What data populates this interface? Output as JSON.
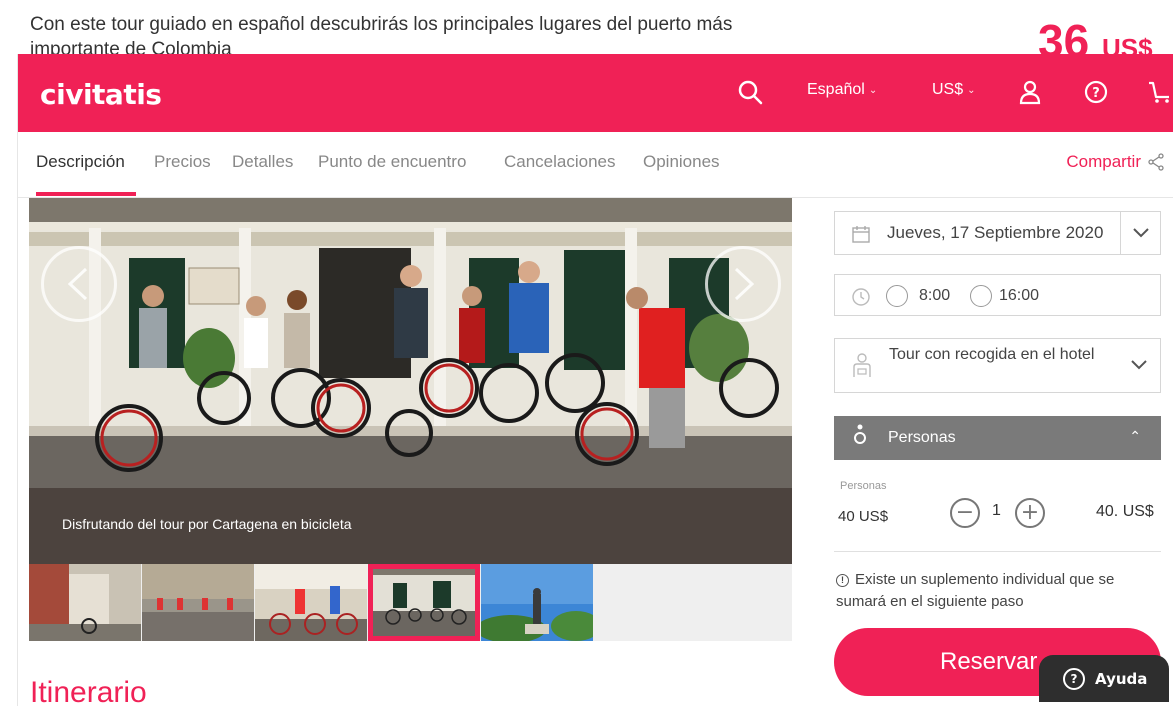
{
  "intro": {
    "text": "Con este tour guiado en español descubrirás los principales lugares del puerto más importante de Colombia",
    "price": "36",
    "currency": "US$"
  },
  "header": {
    "logo": "civitatis",
    "language": "Español",
    "currency": "US$",
    "icons": [
      "search-icon",
      "user-icon",
      "help-icon",
      "cart-icon"
    ],
    "brand_color": "#f02156"
  },
  "tabs": {
    "items": [
      "Descripción",
      "Precios",
      "Detalles",
      "Punto de encuentro",
      "Cancelaciones",
      "Opiniones"
    ],
    "active": "Descripción",
    "share": "Compartir"
  },
  "gallery": {
    "caption": "Disfrutando del tour por Cartagena en bicicleta",
    "selected_thumb": 4,
    "thumb_count": 5
  },
  "booking": {
    "date": "Jueves, 17 Septiembre 2020",
    "times": [
      "8:00",
      "16:00"
    ],
    "pickup": "Tour con recogida en el hotel",
    "personas_header": "Personas",
    "personas_small": "Personas",
    "unit_price": "40 US$",
    "quantity": "1",
    "total": "40. US$",
    "notice": "Existe un suplemento individual que se sumará en el siguiente paso",
    "reserve": "Reservar"
  },
  "section_title": "Itinerario",
  "help": "Ayuda"
}
